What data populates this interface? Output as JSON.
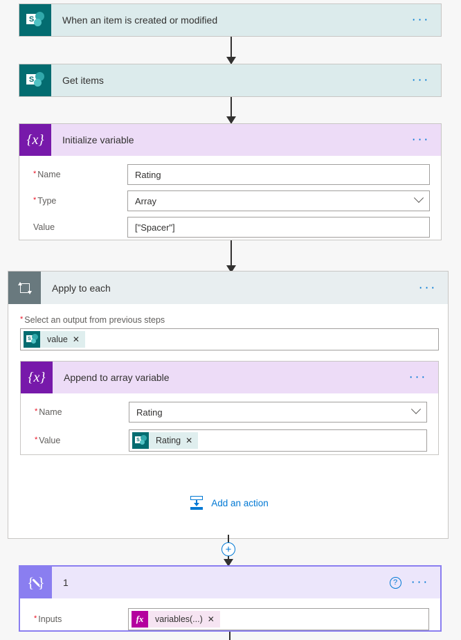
{
  "flow": {
    "steps": [
      {
        "id": "trigger",
        "title": "When an item is created or modified",
        "icon": "sharepoint-icon",
        "type": "sharepoint",
        "menu_label": "···"
      },
      {
        "id": "get-items",
        "title": "Get items",
        "icon": "sharepoint-icon",
        "type": "sharepoint",
        "menu_label": "···"
      },
      {
        "id": "initialize-variable",
        "title": "Initialize variable",
        "icon": "variable-braces-icon",
        "type": "variable",
        "menu_label": "···",
        "fields": [
          {
            "label": "Name",
            "required": true,
            "value": "Rating",
            "control": "text"
          },
          {
            "label": "Type",
            "required": true,
            "value": "Array",
            "control": "dropdown"
          },
          {
            "label": "Value",
            "required": false,
            "value": "[\"Spacer\"]",
            "control": "text"
          }
        ]
      },
      {
        "id": "apply-to-each",
        "title": "Apply to each",
        "icon": "loop-icon",
        "type": "loop",
        "menu_label": "···",
        "output_label": "Select an output from previous steps",
        "output_required": true,
        "output_token": {
          "text": "value",
          "icon": "sharepoint-icon",
          "remove_label": "✕"
        },
        "add_action_label": "Add an action",
        "add_action_icon": "insert-action-icon",
        "nested": {
          "id": "append-to-array-variable",
          "title": "Append to array variable",
          "icon": "variable-braces-icon",
          "type": "variable",
          "menu_label": "···",
          "fields": [
            {
              "label": "Name",
              "required": true,
              "value": "Rating",
              "control": "dropdown"
            },
            {
              "label": "Value",
              "required": true,
              "control": "token",
              "token": {
                "text": "Rating",
                "icon": "sharepoint-icon",
                "remove_label": "✕"
              }
            }
          ]
        }
      },
      {
        "id": "compose-1",
        "title": "1",
        "icon": "compose-pencil-icon",
        "type": "compose",
        "selected": true,
        "menu_label": "···",
        "help_label": "?",
        "fields": [
          {
            "label": "Inputs",
            "required": true,
            "control": "token",
            "token": {
              "text": "variables(...)",
              "icon": "fx-icon",
              "icon_label": "fx",
              "remove_label": "✕"
            }
          }
        ]
      }
    ],
    "insert_button_label": "+",
    "sharepoint_letter": "S"
  },
  "colors": {
    "sharepoint_teal": "#036c70",
    "sharepoint_header": "#dcebec",
    "variable_purple": "#7719aa",
    "variable_header": "#eddcf7",
    "compose_purple": "#8a7ef0",
    "compose_header": "#ece6fb",
    "loop_gray": "#69797e",
    "loop_header": "#e8eef0",
    "link_blue": "#0078d4",
    "required_red": "#e81123",
    "token_teal_bg": "#dfeeee",
    "fx_magenta": "#b4009e",
    "fx_token_bg": "#f6e4f2",
    "page_bg": "#f7f7f7"
  }
}
